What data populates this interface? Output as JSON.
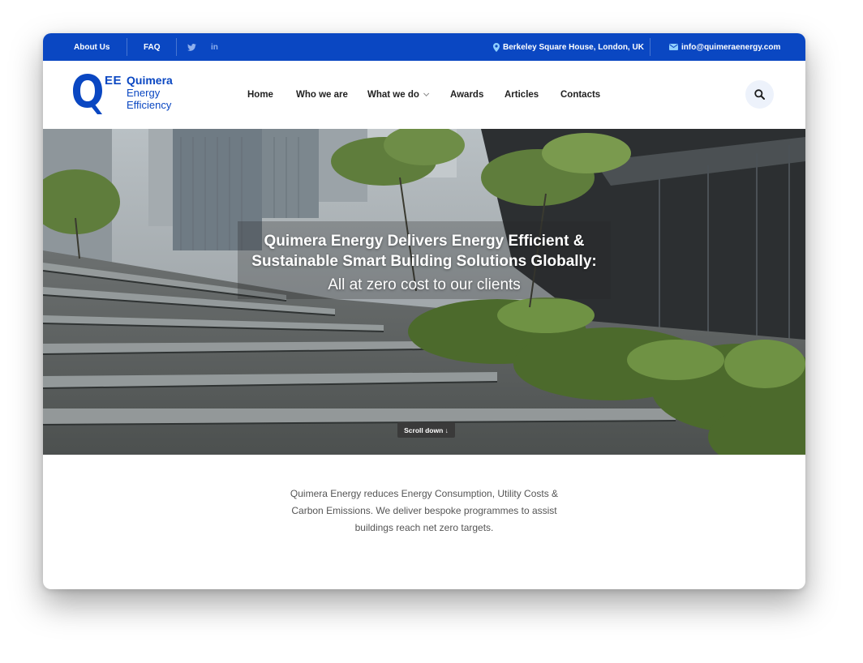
{
  "topbar": {
    "about_label": "About Us",
    "faq_label": "FAQ",
    "twitter_icon": "twitter-icon",
    "linkedin_icon": "linkedin-icon",
    "address": "Berkeley Square House, London, UK",
    "email": "info@quimeraenergy.com"
  },
  "logo": {
    "mark": "Q",
    "ee": "EE",
    "name": "Quimera",
    "line2": "Energy",
    "line3": "Efficiency"
  },
  "nav": {
    "items": [
      "Home",
      "Who we are",
      "What we do",
      "Awards",
      "Articles",
      "Contacts"
    ]
  },
  "hero": {
    "title_line1": "Quimera Energy Delivers Energy Efficient &",
    "title_line2": "Sustainable Smart Building Solutions Globally:",
    "subtitle": "All at zero cost to our clients",
    "scroll_label": "Scroll down ↓"
  },
  "intro": {
    "text": "Quimera Energy reduces Energy Consumption, Utility Costs & Carbon Emissions. We deliver bespoke programmes to assist buildings reach net zero targets."
  },
  "colors": {
    "brand_blue": "#0a47c2",
    "search_bg": "#edf2fb"
  }
}
